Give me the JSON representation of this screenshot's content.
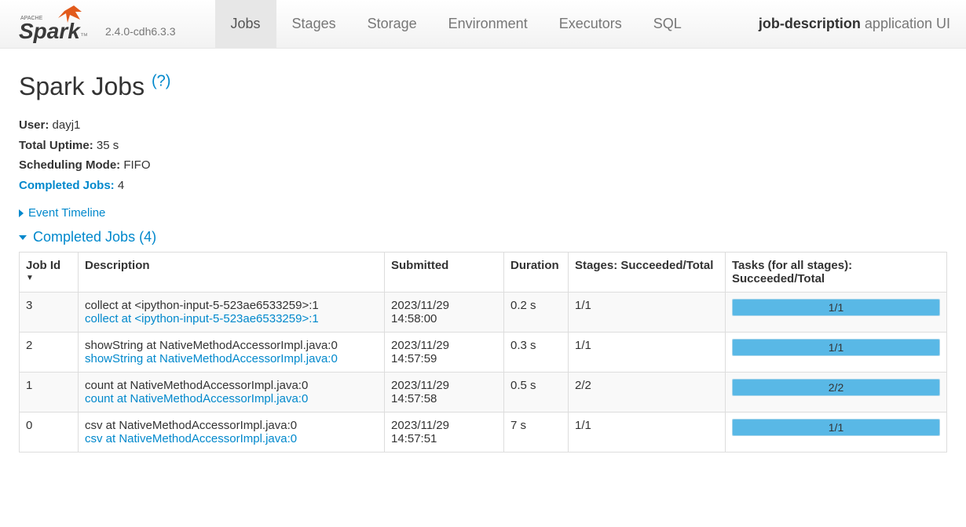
{
  "header": {
    "version": "2.4.0-cdh6.3.3",
    "tabs": [
      "Jobs",
      "Stages",
      "Storage",
      "Environment",
      "Executors",
      "SQL"
    ],
    "active_tab_index": 0,
    "app_name": "job-description",
    "app_suffix": "application UI"
  },
  "page": {
    "title": "Spark Jobs",
    "help": "(?)"
  },
  "summary": {
    "user_label": "User:",
    "user_value": "dayj1",
    "uptime_label": "Total Uptime:",
    "uptime_value": "35 s",
    "sched_label": "Scheduling Mode:",
    "sched_value": "FIFO",
    "completed_label": "Completed Jobs:",
    "completed_value": "4"
  },
  "event_timeline_label": "Event Timeline",
  "completed_section_label": "Completed Jobs (4)",
  "table": {
    "headers": {
      "job_id": "Job Id",
      "description": "Description",
      "submitted": "Submitted",
      "duration": "Duration",
      "stages": "Stages: Succeeded/Total",
      "tasks": "Tasks (for all stages): Succeeded/Total"
    },
    "rows": [
      {
        "id": "3",
        "desc_text": "collect at <ipython-input-5-523ae6533259>:1",
        "desc_link": "collect at <ipython-input-5-523ae6533259>:1",
        "submitted": "2023/11/29 14:58:00",
        "duration": "0.2 s",
        "stages": "1/1",
        "tasks": "1/1"
      },
      {
        "id": "2",
        "desc_text": "showString at NativeMethodAccessorImpl.java:0",
        "desc_link": "showString at NativeMethodAccessorImpl.java:0",
        "submitted": "2023/11/29 14:57:59",
        "duration": "0.3 s",
        "stages": "1/1",
        "tasks": "1/1"
      },
      {
        "id": "1",
        "desc_text": "count at NativeMethodAccessorImpl.java:0",
        "desc_link": "count at NativeMethodAccessorImpl.java:0",
        "submitted": "2023/11/29 14:57:58",
        "duration": "0.5 s",
        "stages": "2/2",
        "tasks": "2/2"
      },
      {
        "id": "0",
        "desc_text": "csv at NativeMethodAccessorImpl.java:0",
        "desc_link": "csv at NativeMethodAccessorImpl.java:0",
        "submitted": "2023/11/29 14:57:51",
        "duration": "7 s",
        "stages": "1/1",
        "tasks": "1/1"
      }
    ]
  }
}
